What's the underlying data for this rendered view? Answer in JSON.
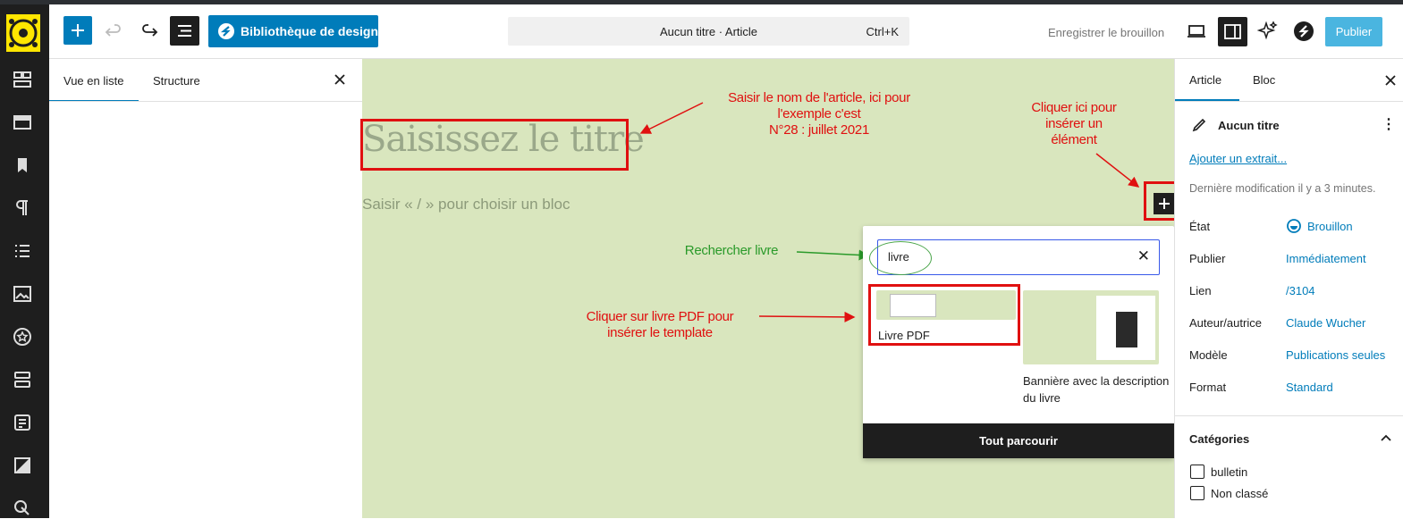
{
  "toolbar": {
    "design_library_label": "Bibliothèque de design",
    "command_title": "Aucun titre · Article",
    "command_shortcut": "Ctrl+K",
    "save_draft_label": "Enregistrer le brouillon",
    "publish_label": "Publier"
  },
  "left_panel": {
    "tabs": [
      "Vue en liste",
      "Structure"
    ]
  },
  "canvas": {
    "title_placeholder": "Saisissez le titre",
    "block_placeholder": "Saisir « / » pour choisir un bloc"
  },
  "annotations": {
    "title_note_1": "Saisir le nom de l'article, ici pour",
    "title_note_2": "l'exemple c'est",
    "title_note_3": "N°28 : juillet 2021",
    "insert_note_1": "Cliquer ici pour",
    "insert_note_2": "insérer un",
    "insert_note_3": "élément",
    "search_note": "Rechercher livre",
    "pdf_note_1": "Cliquer sur livre PDF pour",
    "pdf_note_2": "insérer le template"
  },
  "inserter": {
    "search_value": "livre",
    "patterns": [
      {
        "label": "Livre PDF"
      },
      {
        "label_line1": "Bannière avec la description",
        "label_line2": "du livre"
      }
    ],
    "browse_all_label": "Tout parcourir"
  },
  "right_panel": {
    "tabs": [
      "Article",
      "Bloc"
    ],
    "post_title": "Aucun titre",
    "add_excerpt_link": "Ajouter un extrait...",
    "last_modified": "Dernière modification il y a 3 minutes.",
    "rows": [
      {
        "label": "État",
        "value": "Brouillon"
      },
      {
        "label": "Publier",
        "value": "Immédiatement"
      },
      {
        "label": "Lien",
        "value": "/3104"
      },
      {
        "label": "Auteur/autrice",
        "value": "Claude Wucher"
      },
      {
        "label": "Modèle",
        "value": "Publications seules"
      },
      {
        "label": "Format",
        "value": "Standard"
      }
    ],
    "categories_title": "Catégories",
    "categories": [
      "bulletin",
      "Non classé"
    ]
  },
  "colors": {
    "accent": "#007cba",
    "canvas_bg": "#d9e6be",
    "annotation_red": "#e01010",
    "annotation_green": "#2a9a2a"
  }
}
